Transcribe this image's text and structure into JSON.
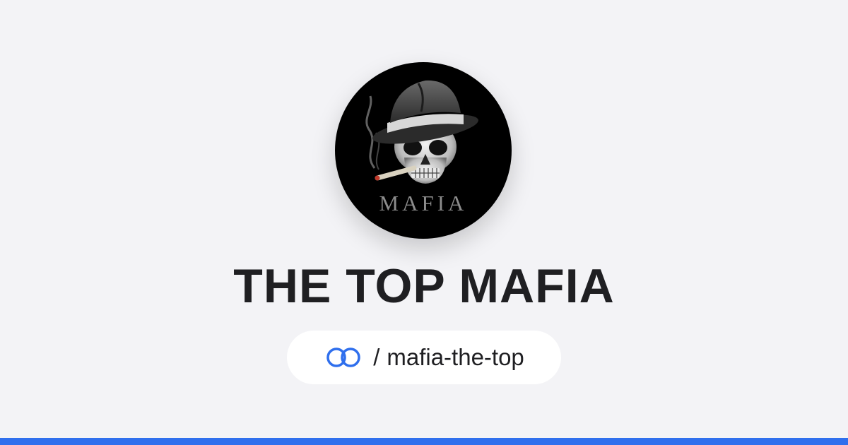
{
  "profile": {
    "logo_text": "MAFIA",
    "name": "THE TOP MAFIA",
    "separator": "/",
    "handle": "mafia-the-top",
    "link_icon": "chain-link-icon"
  },
  "colors": {
    "background": "#f3f3f6",
    "accent": "#2f6fed",
    "title": "#1f1f22",
    "pill": "#ffffff"
  }
}
